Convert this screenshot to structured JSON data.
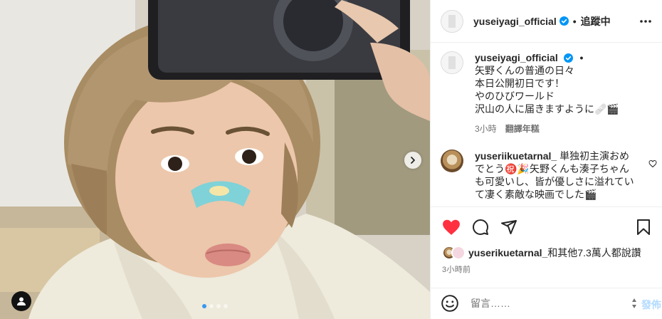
{
  "post": {
    "username": "yuseiyagi_official",
    "separator": "•",
    "follow_state": "追蹤中",
    "caption_lines": [
      "矢野くんの普通の日々",
      "本日公開初日です！",
      "やのひびワールド",
      "沢山の人に届きますように🩹🎬"
    ],
    "caption_time": "3小時",
    "translate_label": "翻譯年糕"
  },
  "comment": {
    "username": "yuseriikuetarnal_",
    "text": "単独初主演おめでとう㊗️🎉矢野くんも湊子ちゃんも可愛いし、皆が優しさに溢れていて凄く素敵な映画でした🎬"
  },
  "likes": {
    "username": "yuserikuetarnal_",
    "rest": "和其他7.3萬人都說讚"
  },
  "time_ago": "3小時前",
  "composer": {
    "placeholder": "留言……",
    "post_label": "發佈"
  },
  "carousel": {
    "slides": 4,
    "active": 0
  },
  "icons": {
    "more": "more-horizontal-icon",
    "verified": "verified-badge-icon",
    "next": "chevron-right-icon",
    "tag": "user-tag-icon",
    "like": "heart-filled-icon",
    "comment": "comment-icon",
    "share": "share-icon",
    "save": "bookmark-icon",
    "emoji": "emoji-icon"
  },
  "colors": {
    "like_red": "#ff3040",
    "verified_blue": "#0095f6",
    "post_disabled": "#b3dbff",
    "dot_active": "#3897f0"
  }
}
